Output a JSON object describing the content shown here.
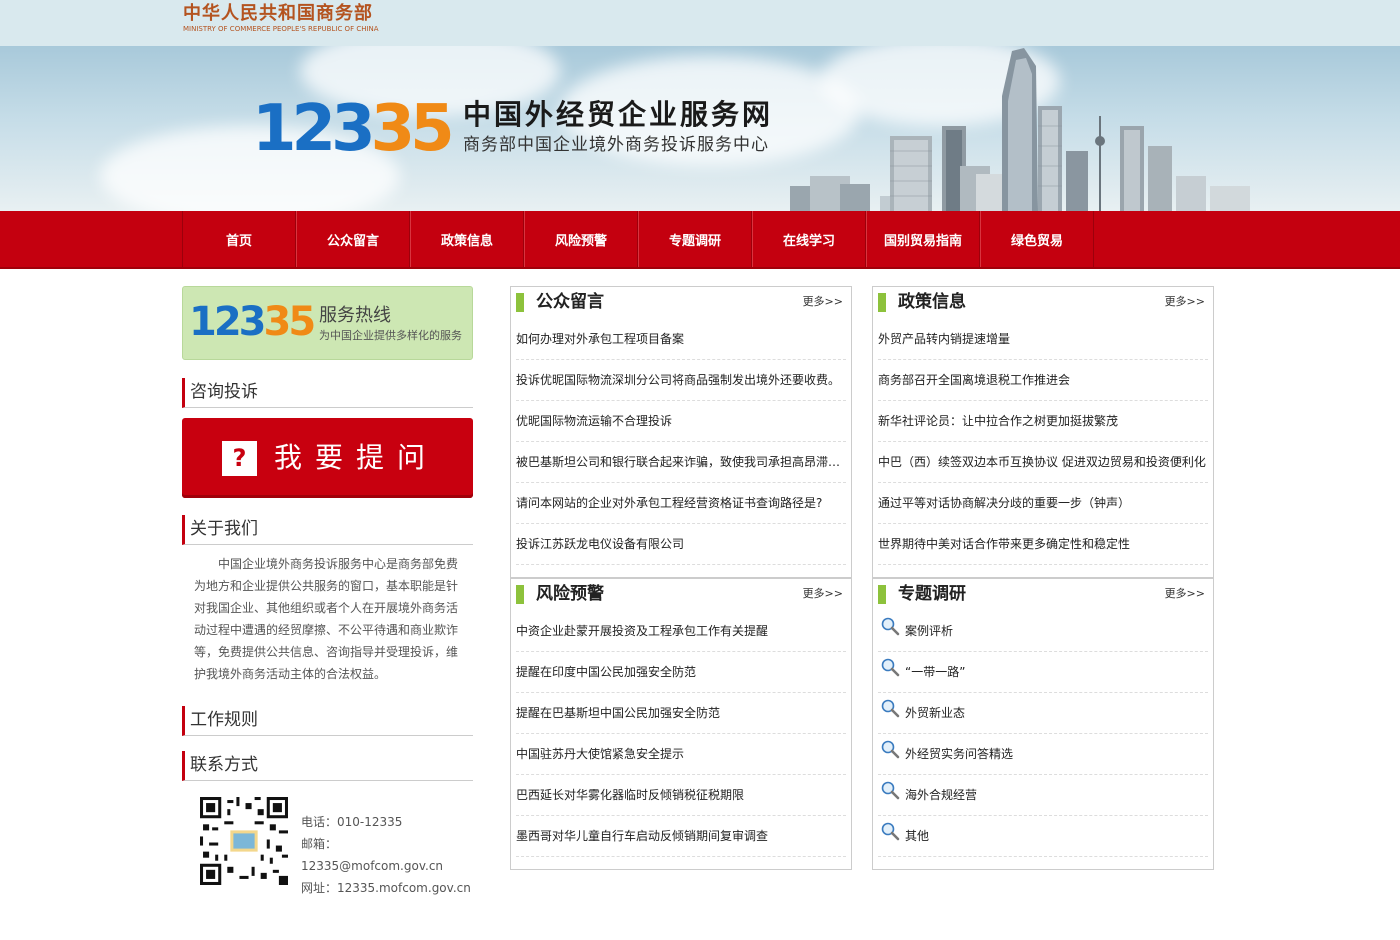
{
  "header": {
    "ministry_cn": "中华人民共和国商务部",
    "ministry_en": "MINISTRY OF COMMERCE PEOPLE'S REPUBLIC OF CHINA",
    "logo_digits_blue": "123",
    "logo_digits_orange": "35",
    "site_title": "中国外经贸企业服务网",
    "site_subtitle": "商务部中国企业境外商务投诉服务中心"
  },
  "nav": {
    "items": [
      "首页",
      "公众留言",
      "政策信息",
      "风险预警",
      "专题调研",
      "在线学习",
      "国别贸易指南",
      "绿色贸易"
    ]
  },
  "sidebar": {
    "hotline": {
      "digits_blue": "123",
      "digits_orange": "35",
      "title": "服务热线",
      "subtitle": "为中国企业提供多样化的服务"
    },
    "consult_heading": "咨询投诉",
    "ask_button_label": "我要提问",
    "ask_button_icon": "?",
    "about_heading": "关于我们",
    "about_text": "中国企业境外商务投诉服务中心是商务部免费为地方和企业提供公共服务的窗口，基本职能是针对我国企业、其他组织或者个人在开展境外商务活动过程中遭遇的经贸摩擦、不公平待遇和商业欺诈等，免费提供公共信息、咨询指导并受理投诉，维护我境外商务活动主体的合法权益。",
    "rules_heading": "工作规则",
    "contact_heading": "联系方式",
    "contact": {
      "phone": "电话：010-12335",
      "email_label": "邮箱：",
      "email": "12335@mofcom.gov.cn",
      "website": "网址：12335.mofcom.gov.cn"
    }
  },
  "panels": {
    "messages": {
      "title": "公众留言",
      "more": "更多>>",
      "items": [
        "如何办理对外承包工程项目备案",
        "投诉优昵国际物流深圳分公司将商品强制发出境外还要收费。",
        "优昵国际物流运输不合理投诉",
        "被巴基斯坦公司和银行联合起来诈骗，致使我司承担高昂滞…",
        "请问本网站的企业对外承包工程经营资格证书查询路径是?",
        "投诉江苏跃龙电仪设备有限公司"
      ]
    },
    "policy": {
      "title": "政策信息",
      "more": "更多>>",
      "items": [
        "外贸产品转内销提速增量",
        "商务部召开全国离境退税工作推进会",
        "新华社评论员：让中拉合作之树更加挺拔繁茂",
        "中巴（西）续签双边本币互换协议 促进双边贸易和投资便利化",
        "通过平等对话协商解决分歧的重要一步（钟声）",
        "世界期待中美对话合作带来更多确定性和稳定性"
      ]
    },
    "risk": {
      "title": "风险预警",
      "more": "更多>>",
      "items": [
        "中资企业赴蒙开展投资及工程承包工作有关提醒",
        "提醒在印度中国公民加强安全防范",
        "提醒在巴基斯坦中国公民加强安全防范",
        "中国驻苏丹大使馆紧急安全提示",
        "巴西延长对华雾化器临时反倾销税征税期限",
        "墨西哥对华儿童自行车启动反倾销期间复审调查"
      ]
    },
    "topics": {
      "title": "专题调研",
      "more": "更多>>",
      "icon": "magnifier-icon",
      "items": [
        "案例评析",
        "“一带一路”",
        "外贸新业态",
        "外经贸实务问答精选",
        "海外合规经营",
        "其他"
      ]
    }
  },
  "colors": {
    "brand_red": "#c4000f",
    "accent_green": "#8dc23c",
    "logo_blue": "#1a6fc4",
    "logo_orange": "#f08a16"
  }
}
